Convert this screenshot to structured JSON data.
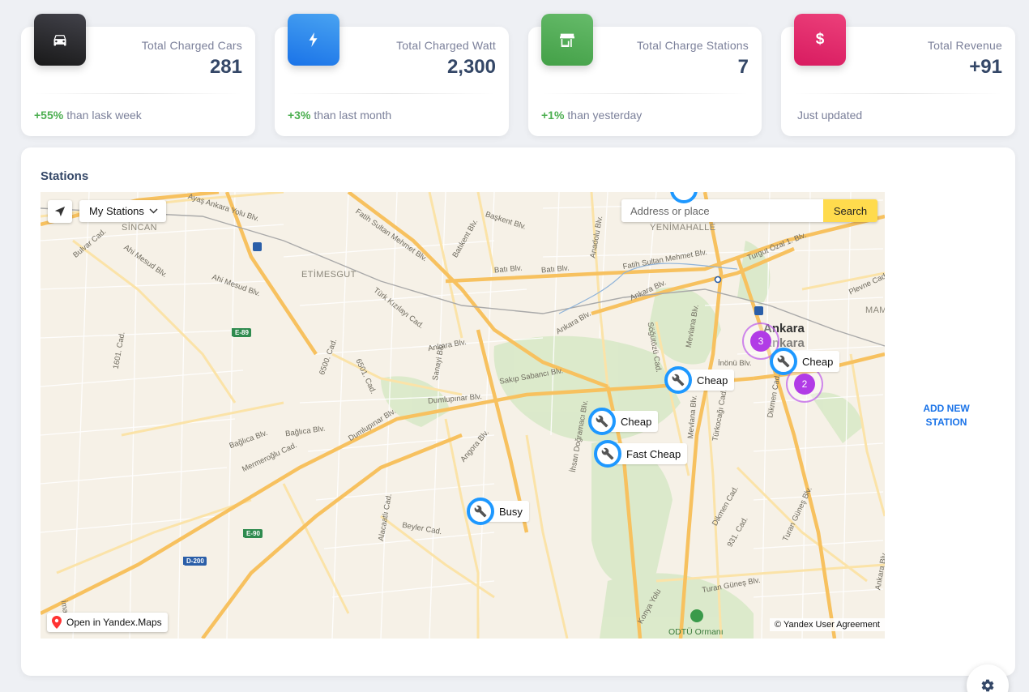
{
  "cards": [
    {
      "title": "Total Charged Cars",
      "value": "281",
      "pct": "+55%",
      "foot": "than lask week",
      "icon": "car-icon",
      "color": "#191919"
    },
    {
      "title": "Total Charged Watt",
      "value": "2,300",
      "pct": "+3%",
      "foot": "than last month",
      "icon": "bolt-icon",
      "color": "#1a73e8"
    },
    {
      "title": "Total Charge Stations",
      "value": "7",
      "pct": "+1%",
      "foot": "than yesterday",
      "icon": "store-icon",
      "color": "#43a047"
    },
    {
      "title": "Total Revenue",
      "value": "+91",
      "pct": "",
      "foot": "Just updated",
      "icon": "dollar-icon",
      "color": "#d81b60"
    }
  ],
  "stations": {
    "title": "Stations",
    "add_button": "ADD NEW STATION",
    "map": {
      "dropdown": "My Stations",
      "search_placeholder": "Address or place",
      "search_button": "Search",
      "open_link": "Open in Yandex.Maps",
      "copyright": "© Yandex User Agreement",
      "labels": {
        "sincan": "SİNCAN",
        "etimesgut": "ETİMESGUT",
        "yenimahalle": "YENİMAHALLE",
        "ankara1": "Ankara",
        "ankara2": "Ankara",
        "mam": "MAM",
        "odtu": "ODTÜ Ormanı",
        "ayas": "Ayaş Ankara Yolu Blv.",
        "fatih1": "Fatih Sultan Mehmet Blv.",
        "baskent": "Başkent Blv.",
        "anadolu": "Anadolu Blv.",
        "turgut": "Turgut Özal 1. Blv.",
        "plevne": "Plevne Cad.",
        "bulvar": "Bulvar Cad.",
        "ahimesud": "Ahi Mesud Blv.",
        "ahimesud2": "Ahi Mesud Blv.",
        "batikent": "Batıkent Blv.",
        "bati": "Batı Blv.",
        "bati2": "Batı Blv.",
        "fatih2": "Fatih Sultan Mehmet Blv.",
        "kizilay": "Türk Kızılayı Cad.",
        "ankarablv1": "Ankara Blv.",
        "ankarablv2": "Ankara Blv.",
        "ankarablv3": "Ankara Blv.",
        "c1601": "1601. Cad.",
        "c6500": "6500. Cad.",
        "c6501": "6501. Cad.",
        "sanayi": "Sanayi Blv.",
        "sakip": "Sakıp Sabancı Blv.",
        "sogutozu": "Söğütözü Cad.",
        "mevlana1": "Mevlana Blv.",
        "mevlana2": "Mevlana Blv.",
        "inonu": "İnönü Blv.",
        "dumlupinar1": "Dumlupınar Blv.",
        "dumlupinar2": "Dumlupınar Blv.",
        "baglica1": "Bağlıca Blv.",
        "baglica2": "Bağlıca Blv.",
        "mermeroglu": "Mermeroğlu Cad.",
        "angora": "Angora Blv.",
        "dogramaci": "İhsan Doğramacı Blv.",
        "dikmen1": "Dikmen Cad.",
        "dikmen2": "Dikmen Cad.",
        "turkocagi": "Türkocağı Cad.",
        "c931": "931. Cad.",
        "turangunes1": "Turan Güneş Blv.",
        "turangunes2": "Turan Güneş Blv.",
        "alacaatli": "Alacaatlı Cad.",
        "beyler": "Beyler Cad.",
        "imar": "İmar",
        "konya": "Konya Yolu",
        "ankarabl4": "Ankara Blv.",
        "e89": "E-89",
        "e90": "E-90",
        "d200": "D-200"
      },
      "markers": [
        {
          "label": "Cheap"
        },
        {
          "label": "Cheap"
        },
        {
          "label": "Cheap"
        },
        {
          "label": "Fast Cheap"
        },
        {
          "label": "Busy"
        }
      ],
      "clusters": [
        {
          "count": "3"
        },
        {
          "count": "2"
        }
      ]
    }
  },
  "colors": {
    "accent": "#1a73e8",
    "marker": "#1e98ff",
    "cluster": "#b13ce6",
    "success": "#4caf50",
    "search": "#ffdb4d"
  }
}
